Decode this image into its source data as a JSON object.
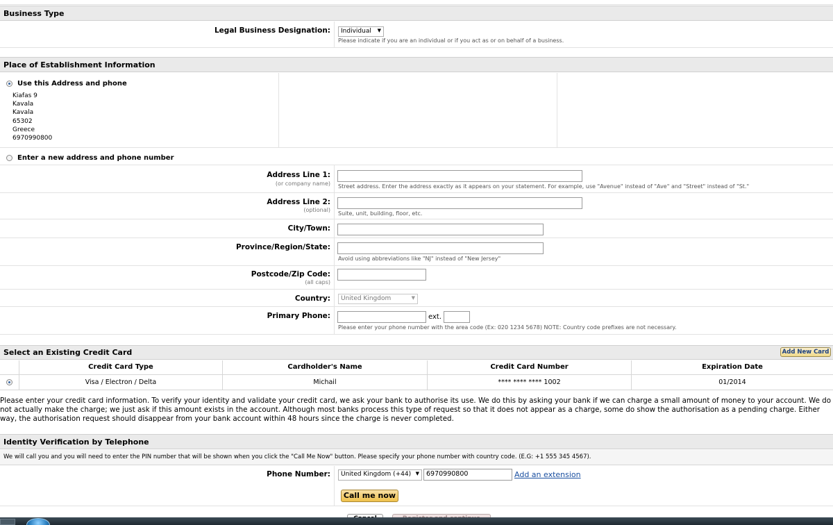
{
  "business_type": {
    "heading": "Business Type",
    "legal_label": "Legal Business Designation:",
    "legal_value": "Individual",
    "legal_hint": "Please indicate if you are an individual or if you act as or on behalf of a business."
  },
  "establishment": {
    "heading": "Place of Establishment Information",
    "use_address_label": "Use this Address and phone",
    "address_lines": [
      "Kiafas 9",
      "Kavala",
      "Kavala",
      "65302",
      "Greece",
      "6970990800"
    ],
    "new_address_label": "Enter a new address and phone number",
    "address1_label": "Address Line 1:",
    "address1_sub": "(or company name)",
    "address1_hint": "Street address. Enter the address exactly as it appears on your statement. For example, use \"Avenue\" instead of \"Ave\" and \"Street\" instead of \"St.\"",
    "address2_label": "Address Line 2:",
    "address2_sub": "(optional)",
    "address2_hint": "Suite, unit, building, floor, etc.",
    "city_label": "City/Town:",
    "province_label": "Province/Region/State:",
    "province_hint": "Avoid using abbreviations like \"NJ\" instead of \"New Jersey\"",
    "postcode_label": "Postcode/Zip Code:",
    "postcode_sub": "(all caps)",
    "country_label": "Country:",
    "country_value": "United Kingdom",
    "phone_label": "Primary Phone:",
    "ext_label": "ext.",
    "phone_hint": "Please enter your phone number with the area code (Ex: 020 1234 5678) NOTE: Country code prefixes are not necessary."
  },
  "credit_card": {
    "heading": "Select an Existing Credit Card",
    "add_new_card": "Add New Card",
    "columns": [
      "Credit Card Type",
      "Cardholder's Name",
      "Credit Card Number",
      "Expiration Date"
    ],
    "row": {
      "type": "Visa / Electron / Delta",
      "name": "Michail",
      "number": "**** **** **** 1002",
      "expiry": "01/2014"
    },
    "notice": "Please enter your credit card information. To verify your identity and validate your credit card, we ask your bank to authorise its use. We do this by asking your bank if we can charge a small amount of money to your account. We do not actually make the charge; we just ask if this amount exists in the account. Although most banks process this type of request so that it does not appear as a charge, some do show the authorisation as a pending charge. Either way, the authorisation request should disappear from your bank account within 48 hours since the charge is never completed."
  },
  "identity": {
    "heading": "Identity Verification by Telephone",
    "info": "We will call you and you will need to enter the PIN number that will be shown when you click the \"Call Me Now\" button. Please specify your phone number with country code. (E.G: +1 555 345 4567).",
    "phone_label": "Phone Number:",
    "country_code": "United Kingdom (+44)",
    "phone_value": "6970990800",
    "add_extension": "Add an extension",
    "call_button": "Call me now"
  },
  "footer": {
    "cancel": "Cancel",
    "register": "Register and continue"
  }
}
